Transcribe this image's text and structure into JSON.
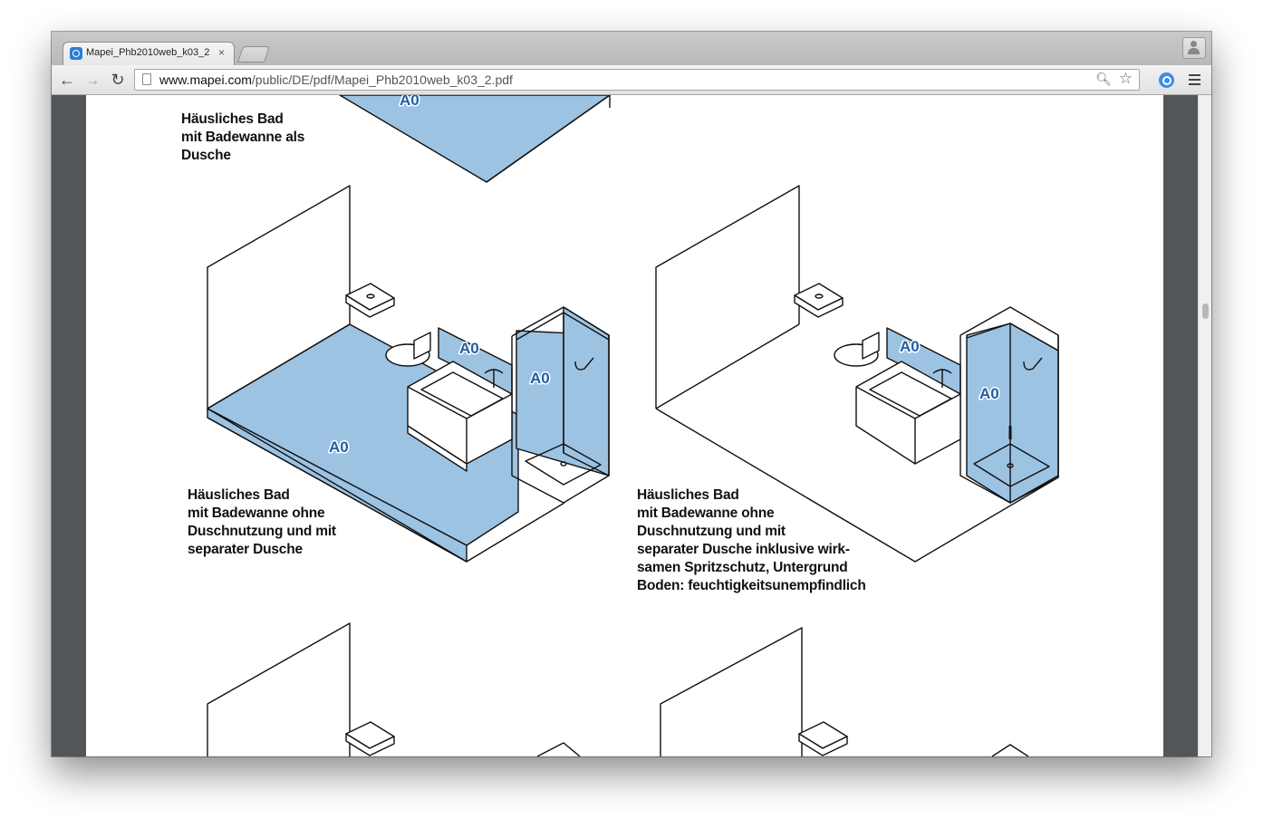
{
  "browser": {
    "tab": {
      "title": "Mapei_Phb2010web_k03_2",
      "close": "×"
    },
    "toolbar": {
      "back": "←",
      "forward": "→",
      "reload": "↻",
      "url_host": "www.mapei.com",
      "url_path": "/public/DE/pdf/Mapei_Phb2010web_k03_2.pdf"
    },
    "icons": [
      "page-icon",
      "zoom-icon",
      "star-icon",
      "extension-icon",
      "menu-icon",
      "profile-icon"
    ]
  },
  "document": {
    "colors": {
      "zone": "#9dc3e3",
      "label": "#1f5ea5"
    },
    "zone_label": "A0",
    "captions": {
      "top": [
        "Häusliches Bad",
        "mit Badewanne als",
        "Dusche"
      ],
      "middle_left": [
        "Häusliches Bad",
        "mit Badewanne ohne",
        "Duschnutzung und mit",
        "separater Dusche"
      ],
      "middle_right": [
        "Häusliches Bad",
        "mit Badewanne ohne",
        "Duschnutzung und mit",
        "separater Dusche inklusive wirk-",
        "samen Spritzschutz, Untergrund",
        "Boden: feuchtigkeitsunempfindlich"
      ]
    }
  }
}
